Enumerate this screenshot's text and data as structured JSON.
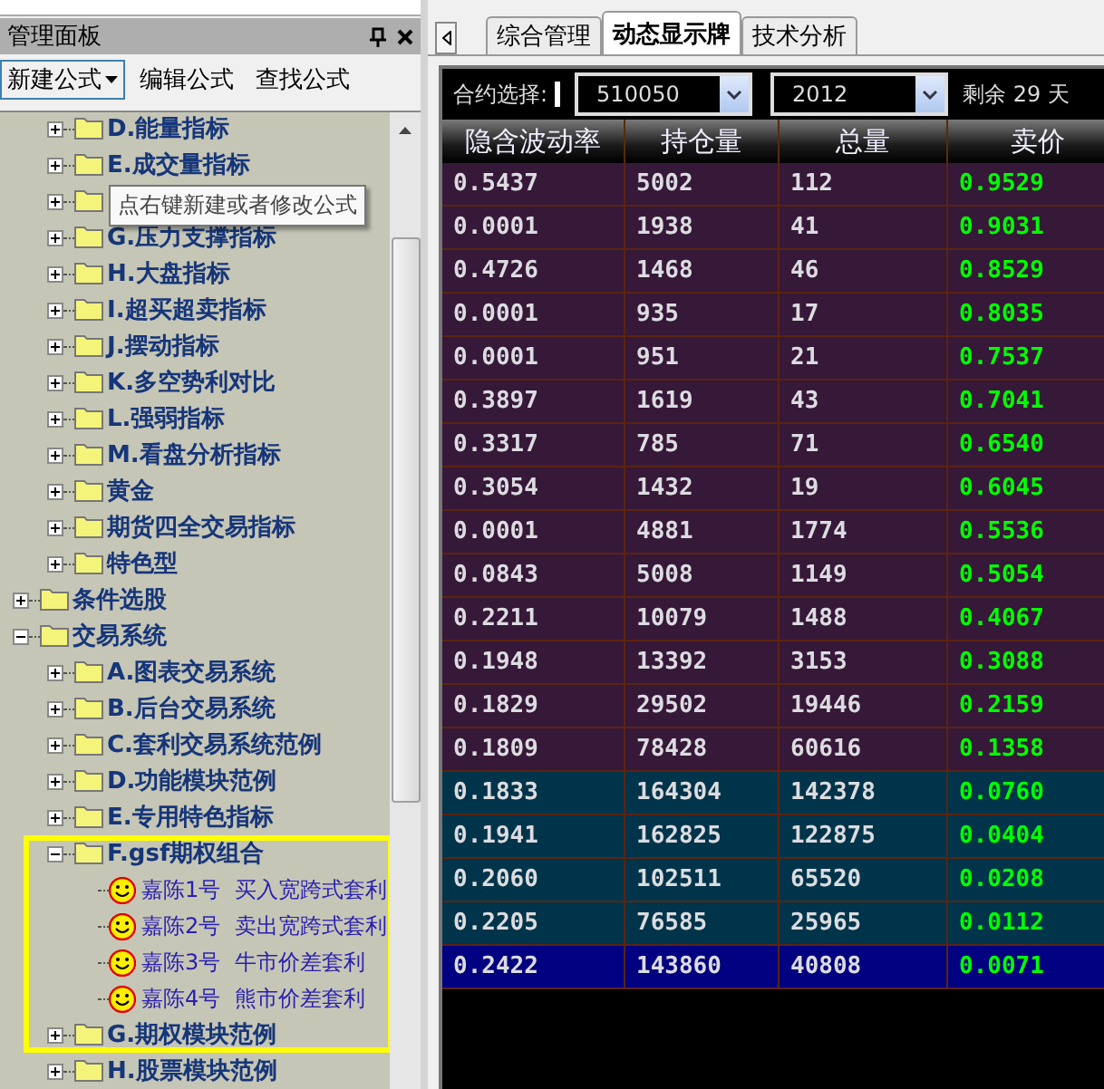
{
  "panel": {
    "title": "管理面板",
    "toolbar": [
      {
        "label": "新建公式",
        "dropdown": true,
        "selected": true
      },
      {
        "label": "编辑公式",
        "dropdown": false,
        "selected": false
      },
      {
        "label": "查找公式",
        "dropdown": false,
        "selected": false
      }
    ]
  },
  "tree": [
    {
      "children": [
        {
          "kind": "folder",
          "label": "D.能量指标",
          "expanded": false
        },
        {
          "kind": "folder",
          "label": "E.成交量指标",
          "expanded": false
        },
        {
          "kind": "folder",
          "expanded": false
        },
        {
          "kind": "folder",
          "label": "G.压力支撑指标",
          "expanded": false
        },
        {
          "kind": "folder",
          "label": "H.大盘指标",
          "expanded": false
        },
        {
          "kind": "folder",
          "label": "I.超买超卖指标",
          "expanded": false
        },
        {
          "kind": "folder",
          "label": "J.摆动指标",
          "expanded": false
        },
        {
          "kind": "folder",
          "label": "K.多空势利对比",
          "expanded": false
        },
        {
          "kind": "folder",
          "label": "L.强弱指标",
          "expanded": false
        },
        {
          "kind": "folder",
          "label": "M.看盘分析指标",
          "expanded": false
        },
        {
          "kind": "folder",
          "label": "黄金",
          "expanded": false
        },
        {
          "kind": "folder",
          "label": "期货四全交易指标",
          "expanded": false
        },
        {
          "kind": "folder",
          "label": "特色型",
          "expanded": false
        }
      ]
    },
    {
      "kind": "folder",
      "label": "条件选股",
      "expanded": false
    },
    {
      "kind": "folder",
      "label": "交易系统",
      "expanded": true,
      "children": [
        {
          "kind": "folder",
          "label": "A.图表交易系统",
          "expanded": false
        },
        {
          "kind": "folder",
          "label": "B.后台交易系统",
          "expanded": false
        },
        {
          "kind": "folder",
          "label": "C.套利交易系统范例",
          "expanded": false
        },
        {
          "kind": "folder",
          "label": "D.功能模块范例",
          "expanded": false
        },
        {
          "kind": "folder",
          "label": "E.专用特色指标",
          "expanded": false
        },
        {
          "kind": "folder",
          "label": "F.gsf期权组合",
          "expanded": true,
          "children": [
            {
              "kind": "formula",
              "label": "嘉陈1号  买入宽跨式套利"
            },
            {
              "kind": "formula",
              "label": "嘉陈2号  卖出宽跨式套利"
            },
            {
              "kind": "formula",
              "label": "嘉陈3号  牛市价差套利"
            },
            {
              "kind": "formula",
              "label": "嘉陈4号  熊市价差套利"
            }
          ]
        },
        {
          "kind": "folder",
          "label": "G.期权模块范例",
          "expanded": false
        },
        {
          "kind": "folder",
          "label": "H.股票模块范例",
          "expanded": false
        }
      ]
    }
  ],
  "tooltip": "点右键新建或者修改公式",
  "tabs": [
    {
      "label": "综合管理",
      "selected": false
    },
    {
      "label": "动态显示牌",
      "selected": true
    },
    {
      "label": "技术分析",
      "selected": false
    }
  ],
  "contract": {
    "label": "合约选择:",
    "code": "510050",
    "month": "2012",
    "remaining": "剩余 29 天"
  },
  "table": {
    "columns": [
      "隐含波动率",
      "持仓量",
      "总量",
      "卖价"
    ],
    "rows": [
      {
        "cells": [
          "0.5437",
          "5002",
          "112",
          "0.9529"
        ],
        "color": "#361838"
      },
      {
        "cells": [
          "0.0001",
          "1938",
          "41",
          "0.9031"
        ],
        "color": "#361838"
      },
      {
        "cells": [
          "0.4726",
          "1468",
          "46",
          "0.8529"
        ],
        "color": "#361838"
      },
      {
        "cells": [
          "0.0001",
          "935",
          "17",
          "0.8035"
        ],
        "color": "#361838"
      },
      {
        "cells": [
          "0.0001",
          "951",
          "21",
          "0.7537"
        ],
        "color": "#361838"
      },
      {
        "cells": [
          "0.3897",
          "1619",
          "43",
          "0.7041"
        ],
        "color": "#361838"
      },
      {
        "cells": [
          "0.3317",
          "785",
          "71",
          "0.6540"
        ],
        "color": "#361838"
      },
      {
        "cells": [
          "0.3054",
          "1432",
          "19",
          "0.6045"
        ],
        "color": "#361838"
      },
      {
        "cells": [
          "0.0001",
          "4881",
          "1774",
          "0.5536"
        ],
        "color": "#361838"
      },
      {
        "cells": [
          "0.0843",
          "5008",
          "1149",
          "0.5054"
        ],
        "color": "#361838"
      },
      {
        "cells": [
          "0.2211",
          "10079",
          "1488",
          "0.4067"
        ],
        "color": "#361838"
      },
      {
        "cells": [
          "0.1948",
          "13392",
          "3153",
          "0.3088"
        ],
        "color": "#361838"
      },
      {
        "cells": [
          "0.1829",
          "29502",
          "19446",
          "0.2159"
        ],
        "color": "#361838"
      },
      {
        "cells": [
          "0.1809",
          "78428",
          "60616",
          "0.1358"
        ],
        "color": "#361838"
      },
      {
        "cells": [
          "0.1833",
          "164304",
          "142378",
          "0.0760"
        ],
        "color": "#00344a"
      },
      {
        "cells": [
          "0.1941",
          "162825",
          "122875",
          "0.0404"
        ],
        "color": "#00344a"
      },
      {
        "cells": [
          "0.2060",
          "102511",
          "65520",
          "0.0208"
        ],
        "color": "#00344a"
      },
      {
        "cells": [
          "0.2205",
          "76585",
          "25965",
          "0.0112"
        ],
        "color": "#00344a"
      },
      {
        "cells": [
          "0.2422",
          "143860",
          "40808",
          "0.0071"
        ],
        "color": "#000080"
      }
    ]
  }
}
